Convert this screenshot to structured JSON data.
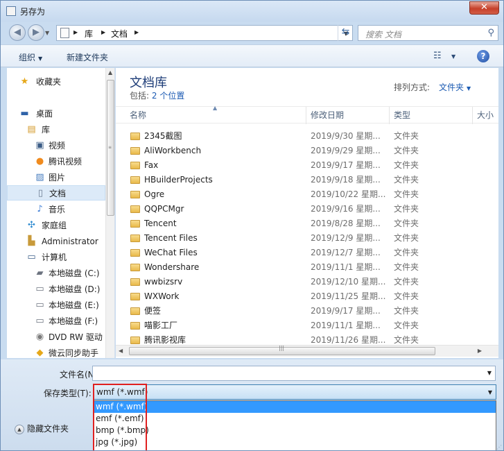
{
  "window": {
    "title": "另存为",
    "close_label": "✕"
  },
  "nav": {
    "back_icon": "arrow-left-icon",
    "forward_icon": "arrow-right-icon",
    "breadcrumb": [
      "库",
      "文档"
    ],
    "search_placeholder": "搜索 文档"
  },
  "toolbar": {
    "organize": "组织",
    "new_folder": "新建文件夹",
    "help": "?"
  },
  "sidebar": {
    "items": [
      {
        "label": "收藏夹",
        "icon": "star-icon"
      },
      {
        "label": "桌面",
        "icon": "desktop-icon"
      },
      {
        "label": "库",
        "icon": "library-icon"
      },
      {
        "label": "视频",
        "icon": "video-icon"
      },
      {
        "label": "腾讯视频",
        "icon": "tencent-video-icon"
      },
      {
        "label": "图片",
        "icon": "picture-icon"
      },
      {
        "label": "文档",
        "icon": "document-icon"
      },
      {
        "label": "音乐",
        "icon": "music-icon"
      },
      {
        "label": "家庭组",
        "icon": "homegroup-icon"
      },
      {
        "label": "Administrator",
        "icon": "user-folder-icon"
      },
      {
        "label": "计算机",
        "icon": "computer-icon"
      },
      {
        "label": "本地磁盘 (C:)",
        "icon": "drive-c-icon"
      },
      {
        "label": "本地磁盘 (D:)",
        "icon": "drive-icon"
      },
      {
        "label": "本地磁盘 (E:)",
        "icon": "drive-icon"
      },
      {
        "label": "本地磁盘 (F:)",
        "icon": "drive-icon"
      },
      {
        "label": "DVD RW 驱动",
        "icon": "dvd-icon"
      },
      {
        "label": "微云同步助手",
        "icon": "weiyun-icon"
      }
    ],
    "selected": "文档"
  },
  "library": {
    "title": "文档库",
    "include_label": "包括:",
    "include_link": "2 个位置",
    "arrange_label": "排列方式:",
    "arrange_value": "文件夹"
  },
  "columns": {
    "name": "名称",
    "date": "修改日期",
    "type": "类型",
    "size": "大小"
  },
  "files": [
    {
      "name": "2345截图",
      "date": "2019/9/30 星期...",
      "type": "文件夹"
    },
    {
      "name": "AliWorkbench",
      "date": "2019/9/29 星期...",
      "type": "文件夹"
    },
    {
      "name": "Fax",
      "date": "2019/9/17 星期...",
      "type": "文件夹"
    },
    {
      "name": "HBuilderProjects",
      "date": "2019/9/18 星期...",
      "type": "文件夹"
    },
    {
      "name": "Ogre",
      "date": "2019/10/22 星期...",
      "type": "文件夹"
    },
    {
      "name": "QQPCMgr",
      "date": "2019/9/16 星期...",
      "type": "文件夹"
    },
    {
      "name": "Tencent",
      "date": "2019/8/28 星期...",
      "type": "文件夹"
    },
    {
      "name": "Tencent Files",
      "date": "2019/12/9 星期...",
      "type": "文件夹"
    },
    {
      "name": "WeChat Files",
      "date": "2019/12/7 星期...",
      "type": "文件夹"
    },
    {
      "name": "Wondershare",
      "date": "2019/11/1 星期...",
      "type": "文件夹"
    },
    {
      "name": "wwbizsrv",
      "date": "2019/12/10 星期...",
      "type": "文件夹"
    },
    {
      "name": "WXWork",
      "date": "2019/11/25 星期...",
      "type": "文件夹"
    },
    {
      "name": "便签",
      "date": "2019/9/17 星期...",
      "type": "文件夹"
    },
    {
      "name": "喵影工厂",
      "date": "2019/11/1 星期...",
      "type": "文件夹"
    },
    {
      "name": "腾讯影视库",
      "date": "2019/11/26 星期...",
      "type": "文件夹"
    }
  ],
  "form": {
    "filename_label": "文件名(N):",
    "filename_value": "",
    "filetype_label": "保存类型(T):",
    "filetype_value": "wmf (*.wmf)",
    "filetype_options": [
      "wmf (*.wmf)",
      "emf (*.emf)",
      "bmp (*.bmp)",
      "jpg (*.jpg)"
    ],
    "hide_folders": "隐藏文件夹"
  },
  "colors": {
    "accent": "#3399ff",
    "highlight_border": "#e02020",
    "close": "#c6402a"
  }
}
